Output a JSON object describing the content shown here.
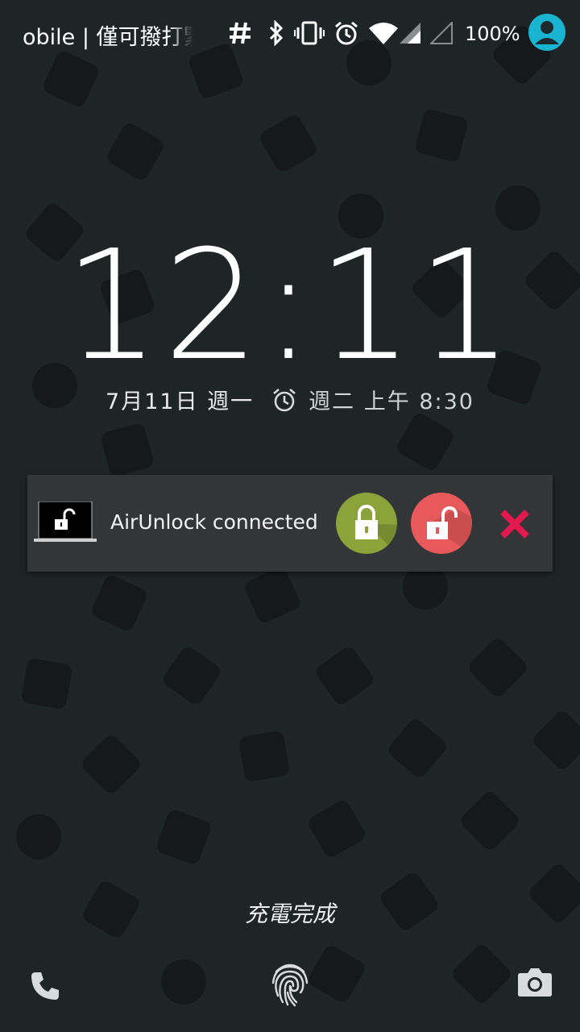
{
  "status_bar": {
    "carrier": "obile | 僅可撥打緊",
    "battery": "100%",
    "icons": [
      "hash-icon",
      "bluetooth-icon",
      "vibrate-icon",
      "alarm-icon",
      "wifi-icon",
      "signal-icon",
      "signal-empty-icon"
    ]
  },
  "lockscreen": {
    "time": "12:11",
    "date": "7月11日 週一",
    "next_alarm": "週二 上午 8:30",
    "charging": "充電完成"
  },
  "notification": {
    "text": "AirUnlock connected",
    "actions": [
      "lock-button",
      "unlock-button",
      "dismiss-button"
    ]
  },
  "colors": {
    "background": "#1f2426",
    "accent_avatar": "#19b4d2",
    "lock_button": "#8aa33a",
    "unlock_button": "#e8595b",
    "dismiss": "#e2194f"
  },
  "bottom_bar": [
    "phone-icon",
    "fingerprint-icon",
    "camera-icon"
  ]
}
